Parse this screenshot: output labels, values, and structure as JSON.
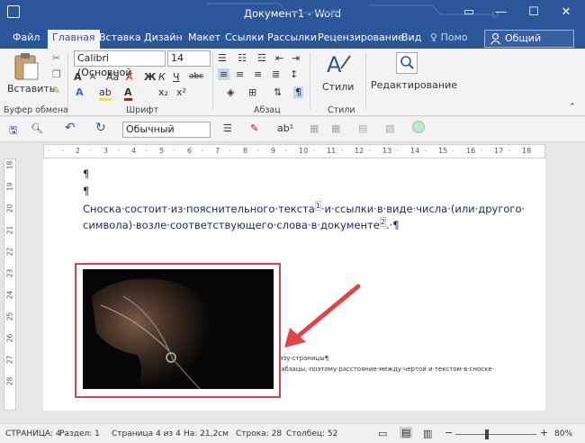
{
  "window": {
    "title": "Документ1 - Word",
    "min": "—",
    "max": "☐",
    "close": "✕",
    "ribbon_opts": "▭"
  },
  "tabs": [
    {
      "label": "Файл"
    },
    {
      "label": "Главная"
    },
    {
      "label": "Вставка"
    },
    {
      "label": "Дизайн"
    },
    {
      "label": "Макет"
    },
    {
      "label": "Ссылки"
    },
    {
      "label": "Рассылки"
    },
    {
      "label": "Рецензирование"
    },
    {
      "label": "Вид"
    },
    {
      "label": "Помо"
    }
  ],
  "share": {
    "label": "Общий доступ"
  },
  "ribbon": {
    "paste_label": "Вставить",
    "clipboard_group": "Буфер обмена",
    "font_name": "Calibri (Основной",
    "font_size": "14",
    "font_group": "Шрифт",
    "bold": "Ж",
    "italic": "К",
    "underline": "Ч",
    "strike": "abc",
    "sub": "x₂",
    "sup": "x²",
    "grow": "A",
    "shrink": "A",
    "aa": "Aa",
    "paragraph_group": "Абзац",
    "styles_label": "Стили",
    "styles_group": "Стили",
    "editing_label": "Редактирование"
  },
  "qat": {
    "style_value": "Обычный"
  },
  "ruler": {
    "marks": [
      "1",
      "1",
      "2",
      "1",
      "3",
      "1",
      "4",
      "1",
      "5",
      "1",
      "6",
      "1",
      "7",
      "1",
      "8",
      "1",
      "9",
      "1",
      "10",
      "1",
      "11",
      "1",
      "12",
      "1",
      "13",
      "1",
      "14",
      "1",
      "15",
      "1",
      "16",
      "1",
      "17",
      "1",
      "18"
    ],
    "vmarks": [
      "18",
      "19",
      "20",
      "21",
      "22",
      "23",
      "24",
      "25",
      "26",
      "27",
      "28"
    ]
  },
  "document": {
    "para1": "¶",
    "para2": "¶",
    "line1": "Сноска·состоит·из·пояснительного·текста",
    "line1b": "·и·ссылки·в·виде·числа·(или·другого·",
    "line2": "символа)·возле·соответствующего·слова·в·документе",
    "line2b": ".·¶",
    "footnote1": "изу·страницы¶",
    "footnote2": "·абзацы,·поэтому·расстояние·между·чертой·и·текстом·в·сноске·"
  },
  "status": {
    "page": "СТРАНИЦА: 4",
    "section": "Раздел: 1",
    "pageof": "Страница 4 из 4",
    "at": "На: 21,2см",
    "line": "Строка: 28",
    "column": "Столбец: 52",
    "zoom": "80%"
  },
  "colors": {
    "accent": "#2b579a",
    "arrow": "#e04448",
    "frame": "#d9434a"
  }
}
